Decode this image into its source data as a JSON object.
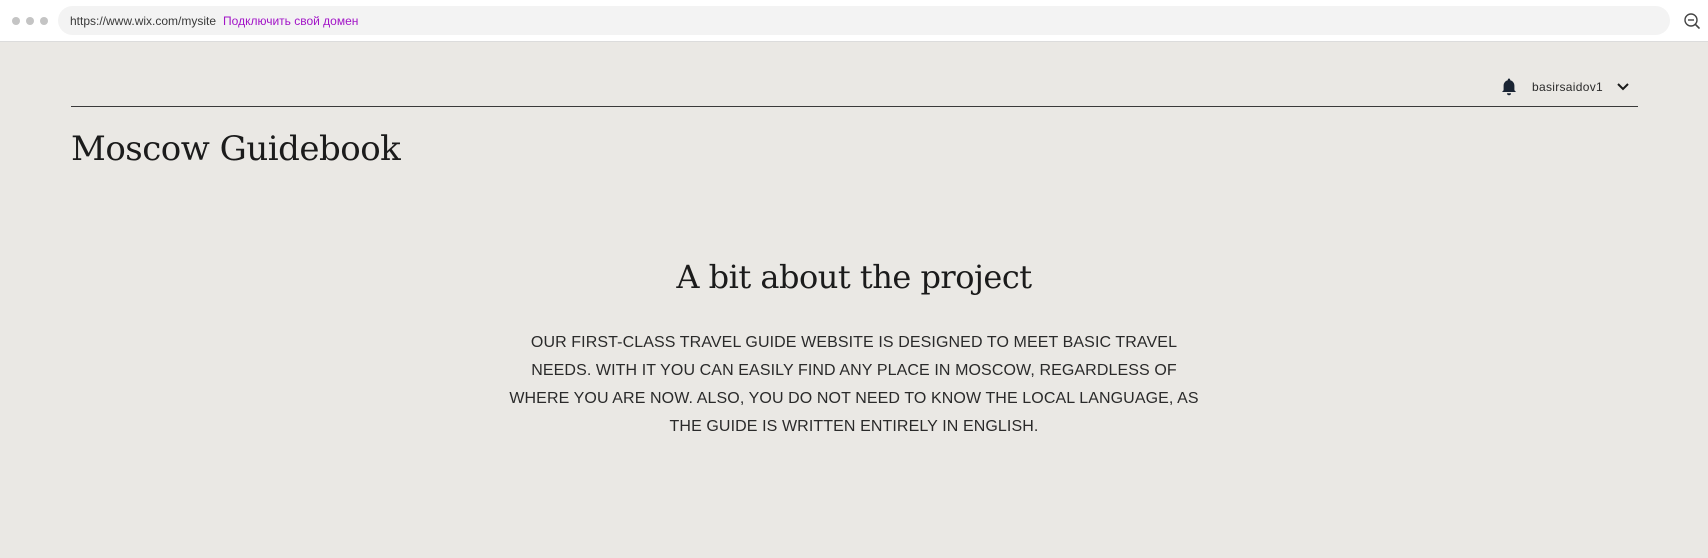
{
  "browser": {
    "url": "https://www.wix.com/mysite",
    "connect_domain_link": "Подключить свой домен",
    "zoom_icon": "zoom-out-icon"
  },
  "header": {
    "notification_icon": "bell-icon",
    "username": "basirsaidov1",
    "menu_icon": "chevron-down-icon",
    "site_title": "Moscow Guidebook"
  },
  "main": {
    "heading": "A bit about the project",
    "body": "OUR FIRST-CLASS TRAVEL GUIDE WEBSITE IS DESIGNED TO MEET BASIC TRAVEL NEEDS. WITH IT YOU CAN EASILY FIND ANY PLACE IN MOSCOW, REGARDLESS OF WHERE YOU ARE NOW. ALSO, YOU DO NOT NEED TO KNOW THE LOCAL LANGUAGE, AS THE GUIDE IS WRITTEN ENTIRELY IN ENGLISH."
  },
  "colors": {
    "page_background": "#eae8e4",
    "link_accent": "#a214c7",
    "text": "#1b1b1b"
  }
}
